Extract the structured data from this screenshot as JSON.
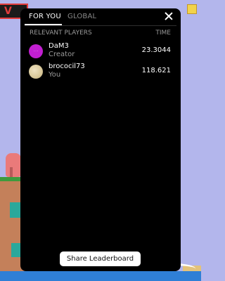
{
  "tabs": [
    {
      "label": "FOR YOU",
      "active": true
    },
    {
      "label": "GLOBAL",
      "active": false
    }
  ],
  "columns": {
    "players": "RELEVANT PLAYERS",
    "time": "TIME"
  },
  "rows": [
    {
      "name": "DaM3",
      "subtitle": "Creator",
      "time": "23.3044",
      "avatar": "creator-avatar"
    },
    {
      "name": "brococil73",
      "subtitle": "You",
      "time": "118.621",
      "avatar": "moon-avatar"
    }
  ],
  "share_label": "Share Leaderboard",
  "colors": {
    "panel": "#000000",
    "background": "#b3b6ec",
    "creator_avatar": "#c21fd1",
    "button": "#ffffff"
  }
}
